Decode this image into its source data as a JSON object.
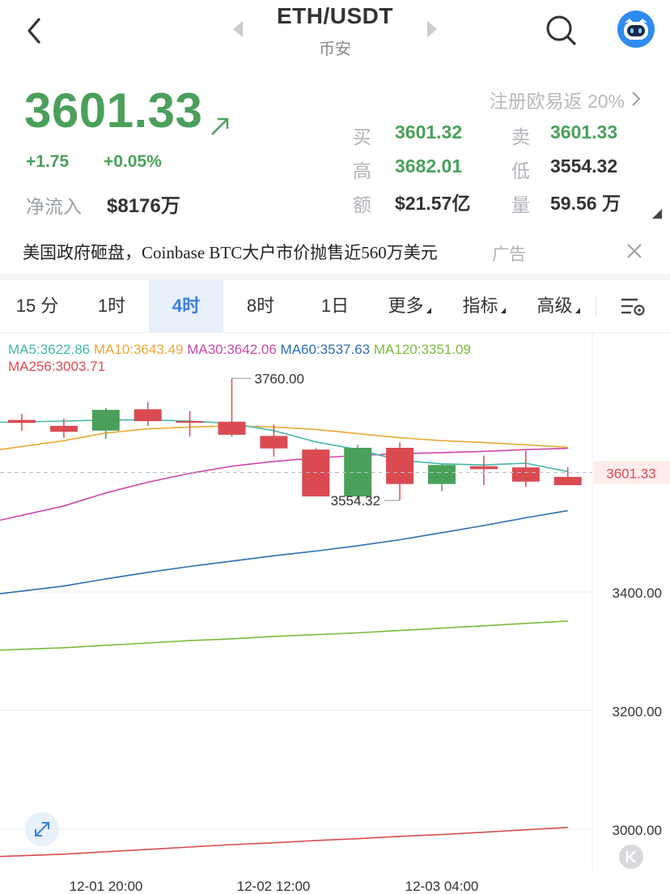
{
  "header": {
    "title": "ETH/USDT",
    "exchange": "币安",
    "icons": [
      "back-icon",
      "prev-pair-icon",
      "next-pair-icon",
      "search-icon",
      "avatar-robot-icon"
    ]
  },
  "ticker": {
    "last_price": "3601.33",
    "change_abs": "+1.75",
    "change_pct": "+0.05%",
    "net_inflow_label": "净流入",
    "net_inflow_value": "$8176万",
    "promo": "注册欧易返 20%",
    "stats": {
      "bid_label": "买",
      "bid": "3601.32",
      "ask_label": "卖",
      "ask": "3601.33",
      "high_label": "高",
      "high": "3682.01",
      "low_label": "低",
      "low": "3554.32",
      "amount_label": "额",
      "amount": "$21.57亿",
      "volume_label": "量",
      "volume": "59.56 万"
    },
    "colors": {
      "up": "#4aa05a",
      "down": "#d94b51"
    }
  },
  "news": {
    "text": "美国政府砸盘，Coinbase BTC大户市价抛售近560万美元",
    "ad_label": "广告"
  },
  "tabs": {
    "t15m": "15 分",
    "t1h": "1时",
    "t4h": "4时",
    "t8h": "8时",
    "t1d": "1日",
    "more": "更多",
    "indicators": "指标",
    "advanced": "高级",
    "active": "4时"
  },
  "chart_data": {
    "type": "candlestick",
    "ma_legend": {
      "ma5": "MA5:3622.86",
      "ma10": "MA10:3643.49",
      "ma30": "MA30:3642.06",
      "ma60": "MA60:3537.63",
      "ma120": "MA120:3351.09",
      "ma256": "MA256:3003.71"
    },
    "ma_colors": {
      "ma5": "#46b8a6",
      "ma10": "#eba934",
      "ma30": "#cf47a9",
      "ma60": "#2c6fb3",
      "ma120": "#7cba3e",
      "ma256": "#d94b51"
    },
    "y_ticks": [
      "3400.00",
      "3200.00",
      "3000.00"
    ],
    "x_labels": [
      "12-01 20:00",
      "12-02 12:00",
      "12-03 04:00"
    ],
    "current_price_label": "3601.33",
    "high_marker": "3760.00",
    "low_marker": "3554.32",
    "candles": [
      {
        "o": 3690,
        "h": 3700,
        "l": 3672,
        "c": 3685
      },
      {
        "o": 3680,
        "h": 3692,
        "l": 3660,
        "c": 3670
      },
      {
        "o": 3672,
        "h": 3710,
        "l": 3658,
        "c": 3707
      },
      {
        "o": 3708,
        "h": 3720,
        "l": 3680,
        "c": 3688
      },
      {
        "o": 3688,
        "h": 3705,
        "l": 3662,
        "c": 3686
      },
      {
        "o": 3687,
        "h": 3760,
        "l": 3662,
        "c": 3665
      },
      {
        "o": 3663,
        "h": 3682,
        "l": 3628,
        "c": 3642
      },
      {
        "o": 3640,
        "h": 3642,
        "l": 3564,
        "c": 3561
      },
      {
        "o": 3561,
        "h": 3648,
        "l": 3556,
        "c": 3643
      },
      {
        "o": 3643,
        "h": 3652,
        "l": 3554.32,
        "c": 3582
      },
      {
        "o": 3582,
        "h": 3615,
        "l": 3570,
        "c": 3614
      },
      {
        "o": 3612,
        "h": 3630,
        "l": 3580,
        "c": 3607
      },
      {
        "o": 3610,
        "h": 3638,
        "l": 3577,
        "c": 3586
      },
      {
        "o": 3594,
        "h": 3610,
        "l": 3580,
        "c": 3580
      }
    ],
    "ma_series": {
      "ma5": [
        3686,
        3688,
        3690,
        3690,
        3688,
        3684,
        3672,
        3653,
        3640,
        3622,
        3616,
        3614,
        3617,
        3603
      ],
      "ma10": [
        3640,
        3655,
        3668,
        3675,
        3678,
        3680,
        3678,
        3674,
        3667,
        3660,
        3655,
        3652,
        3648,
        3644
      ],
      "ma30": [
        3521,
        3545,
        3567,
        3585,
        3600,
        3612,
        3620,
        3626,
        3630,
        3633,
        3635,
        3637,
        3640,
        3642
      ],
      "ma60": [
        3397,
        3410,
        3422,
        3433,
        3443,
        3452,
        3461,
        3469,
        3478,
        3488,
        3500,
        3512,
        3525,
        3537
      ],
      "ma120": [
        3302,
        3306,
        3310,
        3314,
        3318,
        3321,
        3325,
        3328,
        3331,
        3335,
        3339,
        3343,
        3347,
        3351
      ],
      "ma256": [
        2954,
        2958,
        2962,
        2966,
        2970,
        2974,
        2977,
        2981,
        2984,
        2988,
        2991,
        2995,
        2999,
        3003
      ]
    },
    "grid": true
  }
}
